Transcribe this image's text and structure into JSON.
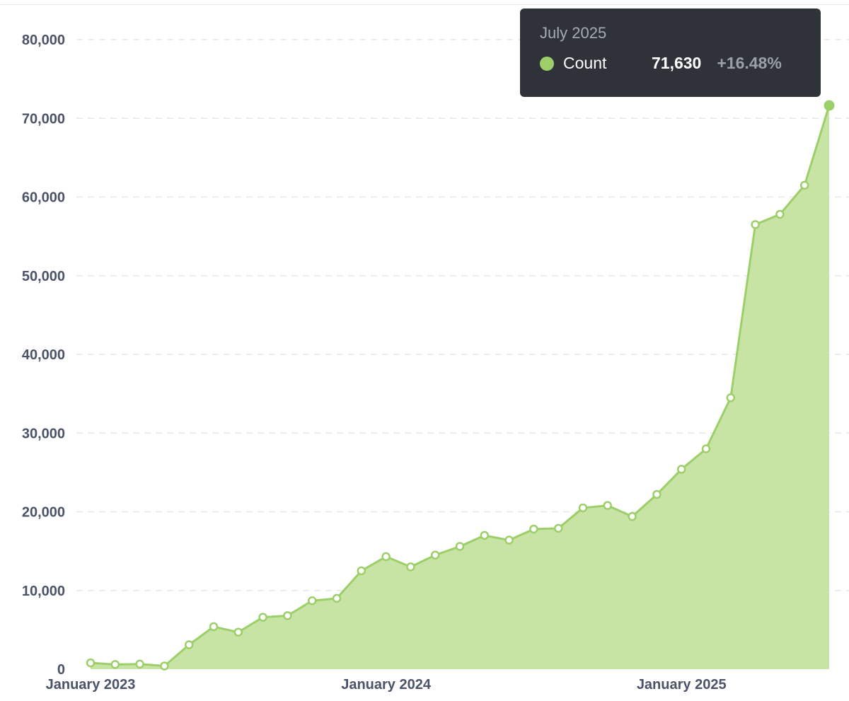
{
  "colors": {
    "line": "#9ccf6a",
    "fill": "#c8e4a4",
    "grid": "#e3e6ea",
    "tick_text": "#4a5368",
    "tooltip_bg": "#2f3339"
  },
  "tooltip": {
    "title": "July 2025",
    "series_name": "Count",
    "value": "71,630",
    "change": "+16.48%"
  },
  "chart_data": {
    "type": "area",
    "title": "",
    "xlabel": "",
    "ylabel": "",
    "grid": true,
    "ylim": [
      0,
      80000
    ],
    "yticks": [
      0,
      10000,
      20000,
      30000,
      40000,
      50000,
      60000,
      70000,
      80000
    ],
    "ytick_labels": [
      "0",
      "10,000",
      "20,000",
      "30,000",
      "40,000",
      "50,000",
      "60,000",
      "70,000",
      "80,000"
    ],
    "xtick_labels": [
      "January 2023",
      "January 2024",
      "January 2025"
    ],
    "x": [
      "2023-01",
      "2023-02",
      "2023-03",
      "2023-04",
      "2023-05",
      "2023-06",
      "2023-07",
      "2023-08",
      "2023-09",
      "2023-10",
      "2023-11",
      "2023-12",
      "2024-01",
      "2024-02",
      "2024-03",
      "2024-04",
      "2024-05",
      "2024-06",
      "2024-07",
      "2024-08",
      "2024-09",
      "2024-10",
      "2024-11",
      "2024-12",
      "2025-01",
      "2025-02",
      "2025-03",
      "2025-04",
      "2025-05",
      "2025-06",
      "2025-07"
    ],
    "series": [
      {
        "name": "Count",
        "values": [
          800,
          600,
          650,
          400,
          3100,
          5400,
          4700,
          6600,
          6800,
          8700,
          9000,
          12500,
          14300,
          13000,
          14500,
          15600,
          17000,
          16400,
          17800,
          17900,
          20500,
          20800,
          19400,
          22200,
          25400,
          28000,
          34500,
          56500,
          57800,
          61500,
          71630
        ]
      }
    ]
  }
}
